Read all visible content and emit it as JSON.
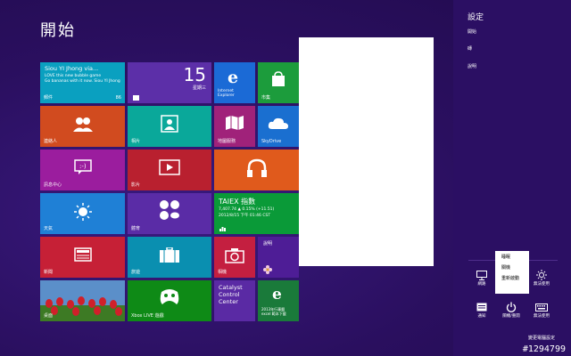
{
  "start": {
    "title": "開始"
  },
  "tiles": {
    "people_app": {
      "line1": "Siou YI Jhong via...",
      "line2": "LOVE this new bubble game",
      "line3": "Go bananas with it now. Siou YI Jhong",
      "label": "郵件",
      "count": "86"
    },
    "calendar": {
      "day": "15",
      "weekday": "星期三"
    },
    "ie": {
      "label1": "Internet",
      "label2": "Explorer"
    },
    "store": {
      "label": "市集"
    },
    "people": {
      "label": "連絡人"
    },
    "photos": {
      "label": "相片"
    },
    "maps": {
      "label": "地圖服務"
    },
    "skydrive": {
      "label": "SkyDrive"
    },
    "messaging": {
      "label": "訊息中心"
    },
    "video": {
      "label": "影片"
    },
    "music": {
      "label": ""
    },
    "weather": {
      "label": "天氣"
    },
    "sports": {
      "label": "體育"
    },
    "finance": {
      "title": "TAIEX 指數",
      "line1": "7,407.74 ▲ 0.15% (+11.51)",
      "line2": "2012/8/15 下午 01:46 CST"
    },
    "news": {
      "label": "新聞"
    },
    "travel": {
      "label": "旅遊"
    },
    "camera": {
      "label": "相機"
    },
    "desktop": {
      "label": "桌面"
    },
    "xbox": {
      "label": "Xbox LIVE 遊戲"
    },
    "catalyst": {
      "line1": "Catalyst",
      "line2": "Control",
      "line3": "Center"
    },
    "excel": {
      "line1": "2013年行事曆",
      "line2": "excel 範本下載"
    },
    "help": {
      "label": "說明"
    }
  },
  "charm": {
    "heading": "設定",
    "items": [
      "開始",
      "磚",
      "說明"
    ],
    "quick": {
      "network": "網路",
      "volume": "無法使用",
      "notifications": "通知",
      "power": "關機/重開",
      "brightness": "無法使用",
      "keyboard": "無法使用"
    },
    "power_menu": [
      "睡眠",
      "關機",
      "重新啟動"
    ],
    "change_pc": "變更電腦設定"
  },
  "watermark": "#1294799",
  "colors": {
    "background": "#2a0f5f",
    "charm": "#2b0f63"
  }
}
